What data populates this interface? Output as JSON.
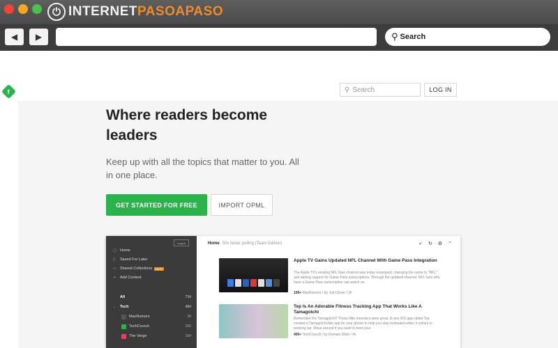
{
  "browser": {
    "brand_prefix": "INTERNET",
    "brand_accent": "PASOAPASO",
    "search_label": "Search"
  },
  "header": {
    "search_placeholder": "Search",
    "login_label": "LOG IN"
  },
  "hero": {
    "headline": "Where readers become leaders",
    "subline": "Keep up with all the topics that matter to you. All in one place.",
    "primary_cta": "GET STARTED FOR FREE",
    "secondary_cta": "IMPORT OPML"
  },
  "preview": {
    "logout": "Logout",
    "nav": [
      {
        "label": "Home"
      },
      {
        "label": "Saved For Later"
      },
      {
        "label": "Shared Collections",
        "badge": "NEW"
      },
      {
        "label": "Add Content"
      }
    ],
    "feeds": [
      {
        "label": "All",
        "count": "734"
      },
      {
        "label": "Tech",
        "count": "484"
      },
      {
        "label": "MacRumors",
        "count": "35"
      },
      {
        "label": "TechCrunch",
        "count": "295"
      },
      {
        "label": "The Verge",
        "count": "154"
      }
    ],
    "header_title": "Home",
    "header_sub": "50x faster polling (Team Edition)",
    "articles": [
      {
        "title": "Apple TV Gains Updated NFL Channel With Game Pass Integration",
        "text": "The Apple TV's existing NFL Now channel was today revamped, changing the name to \"NFL\" and adding support for Game Pass subscriptions. Through the updated channel, NFL fans who have a Game Pass subscription can watch on-",
        "meta_count": "100+",
        "meta_rest": " MacRumors / by Juli Clover / 3h"
      },
      {
        "title": "Tep Is An Adorable Fitness Tracking App That Works Like A Tamagotchi",
        "text": "Remember the Tamagotchi? Those little monsters were great. A new iOS app called Tep created a Tamagotchi-like app for your phone to help you stay motivated when it comes to working out. Move around if you want to feed your",
        "meta_count": "400+",
        "meta_rest": " TechCrunch / by Romain Dillet / 4h"
      }
    ]
  },
  "colors": {
    "accent_green": "#2bb24c",
    "brand_orange": "#f08a2f",
    "sidebar_dark": "#3b3b3b"
  }
}
